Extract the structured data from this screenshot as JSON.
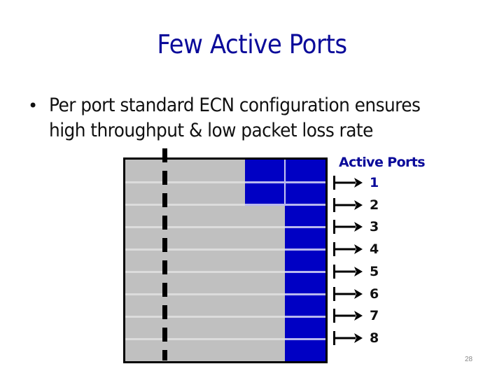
{
  "slide": {
    "title": "Few Active Ports",
    "bullets": [
      {
        "lines": [
          "Per port standard ECN configuration ensures",
          "high throughput & low packet loss rate"
        ]
      }
    ],
    "bullet_glyph": "•",
    "page_number": "28"
  },
  "diagram": {
    "ports_label": "Active Ports",
    "ports": [
      "1",
      "2",
      "3",
      "4",
      "5",
      "6",
      "7",
      "8"
    ],
    "active_port_count": 8,
    "queue_rows": 9,
    "colors": {
      "queue_fill": "#c0c0c0",
      "packet_fill": "#0000c4",
      "title": "#0a0a9a",
      "border": "#000000"
    },
    "icons": {
      "arrow": "right-arrow-from-bar-icon",
      "threshold": "dashed-threshold-line"
    }
  }
}
